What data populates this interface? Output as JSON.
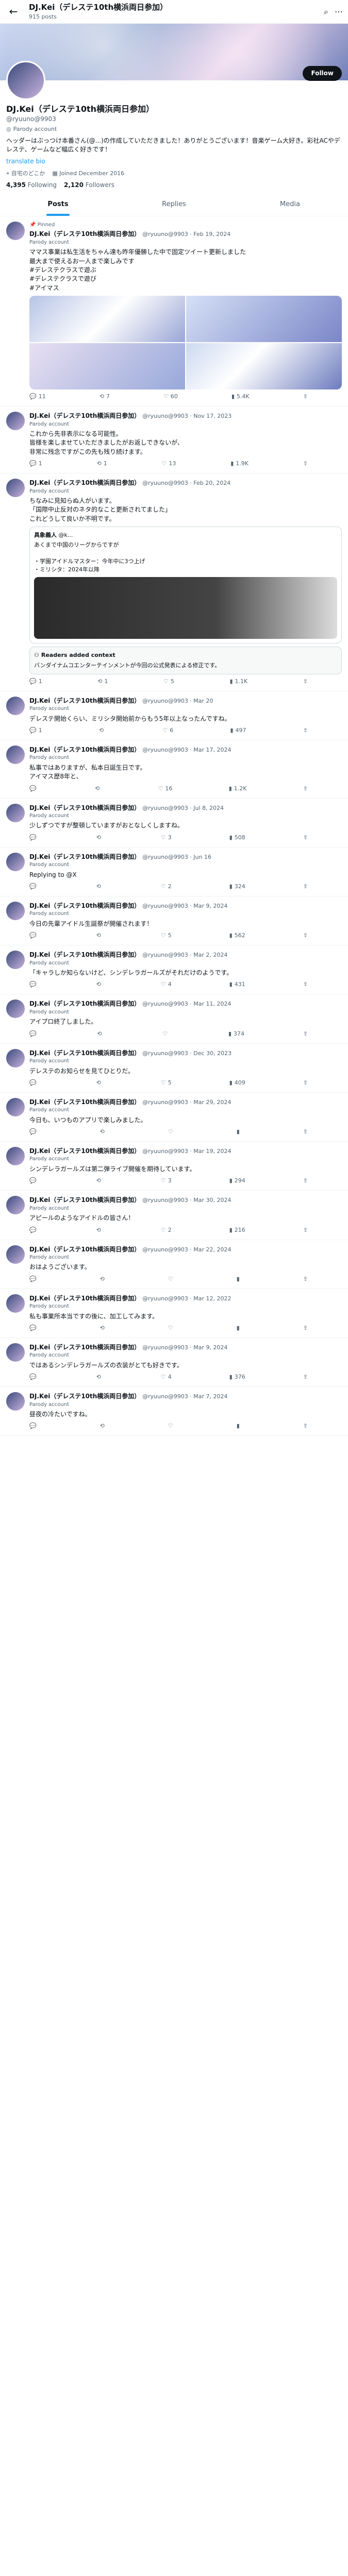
{
  "top": {
    "name": "DJ.Kei（デレステ10th横浜両日参加）",
    "posts": "915 posts"
  },
  "profile": {
    "name": "DJ.Kei（デレステ10th横浜両日参加）",
    "handle": "@ryuuno@9903",
    "parody": "Parody account",
    "follow": "Follow",
    "bio": "ヘッダーはぶっつけ本番さん(@...)の作成していただきました！ありがとうございます！音楽ゲーム大好き。彩社ACやデレステ、ゲームなど幅広く好きです！",
    "bio2": "translate bio",
    "location": "自宅のどこか",
    "joined": "Joined December 2016",
    "following": "4,395",
    "following_label": "Following",
    "followers": "2,120",
    "followers_label": "Followers"
  },
  "tabs": {
    "posts": "Posts",
    "replies": "Replies",
    "media": "Media"
  },
  "posts": [
    {
      "pinned": "Pinned",
      "name": "DJ.Kei（デレステ10th横浜両日参加）",
      "handle": "@ryuuno@9903 · Feb 19, 2024",
      "parody": "Parody account",
      "text": "ママス事業は私生活をちゃん達も昨年優勝した中で固定ツイート更新しました\n最大まで使えるお一人まで楽しみです\n#デレステクラスで遊ぶ\n#デレステクラスで遊び\n#アイマス",
      "reply": "11",
      "rt": "7",
      "like": "60",
      "views": "5.4K",
      "imgs": true
    },
    {
      "name": "DJ.Kei（デレステ10th横浜両日参加）",
      "handle": "@ryuuno@9903 · Nov 17, 2023",
      "parody": "Parody account",
      "text": "これから先非表示になる可能性。\n皆様を楽しませていただきましたがお返しできないが、\n非常に残念ですがこの先も残り続けます。",
      "reply": "1",
      "rt": "1",
      "like": "13",
      "views": "1.9K"
    },
    {
      "name": "DJ.Kei（デレステ10th横浜両日参加）",
      "handle": "@ryuuno@9903 · Feb 20, 2024",
      "parody": "Parody account",
      "text": "ちなみに見知らぬ人がいます。\n「国際中止反対のネタ的なこと更新されてました」\nこれどうして良いか不明です。",
      "reply": "1",
      "rt": "1",
      "like": "5",
      "views": "1.1K",
      "quote": true
    },
    {
      "name": "DJ.Kei（デレステ10th横浜両日参加）",
      "handle": "@ryuuno@9903 · Mar 20",
      "parody": "Parody account",
      "text": "デレステ開始くらい、ミリシタ開始前からもう5年以上なったんですね。",
      "reply": "1",
      "rt": "",
      "like": "6",
      "views": "497"
    },
    {
      "name": "DJ.Kei（デレステ10th横浜両日参加）",
      "handle": "@ryuuno@9903 · Mar 17, 2024",
      "parody": "Parody account",
      "text": "私事ではありますが、私本日誕生日です。\nアイマス歴8年と、",
      "reply": "",
      "rt": "",
      "like": "16",
      "views": "1.2K"
    },
    {
      "name": "DJ.Kei（デレステ10th横浜両日参加）",
      "handle": "@ryuuno@9903 · Jul 8, 2024",
      "parody": "Parody account",
      "text": "少しずつですが整頓していますがおとなしくしますね。",
      "reply": "",
      "rt": "",
      "like": "3",
      "views": "508"
    },
    {
      "name": "DJ.Kei（デレステ10th横浜両日参加）",
      "handle": "@ryuuno@9903 · Jun 16",
      "parody": "Parody account",
      "text": "Replying to @X",
      "reply": "",
      "rt": "",
      "like": "2",
      "views": "324"
    },
    {
      "name": "DJ.Kei（デレステ10th横浜両日参加）",
      "handle": "@ryuuno@9903 · Mar 9, 2024",
      "parody": "Parody account",
      "text": "今日の先輩アイドル生誕祭が開催されます！",
      "reply": "",
      "rt": "",
      "like": "5",
      "views": "562"
    },
    {
      "name": "DJ.Kei（デレステ10th横浜両日参加）",
      "handle": "@ryuuno@9903 · Mar 2, 2024",
      "parody": "Parody account",
      "text": "「キャラしか知らないけど、シンデレラガールズがそれだけのようです。",
      "reply": "",
      "rt": "",
      "like": "4",
      "views": "431"
    },
    {
      "name": "DJ.Kei（デレステ10th横浜両日参加）",
      "handle": "@ryuuno@9903 · Mar 11, 2024",
      "parody": "Parody account",
      "text": "アイプロ終了しました。",
      "reply": "",
      "rt": "",
      "like": "",
      "views": "374"
    },
    {
      "name": "DJ.Kei（デレステ10th横浜両日参加）",
      "handle": "@ryuuno@9903 · Dec 30, 2023",
      "parody": "Parody account",
      "text": "デレステのお知らせを見てひとりだ。",
      "reply": "",
      "rt": "",
      "like": "5",
      "views": "409"
    },
    {
      "name": "DJ.Kei（デレステ10th横浜両日参加）",
      "handle": "@ryuuno@9903 · Mar 29, 2024",
      "parody": "Parody account",
      "text": "今日も、いつものアプリで楽しみました。",
      "reply": "",
      "rt": "",
      "like": "",
      "views": ""
    },
    {
      "name": "DJ.Kei（デレステ10th横浜両日参加）",
      "handle": "@ryuuno@9903 · Mar 19, 2024",
      "parody": "Parody account",
      "text": "シンデレラガールズは第二弾ライブ開催を期待しています。",
      "reply": "",
      "rt": "",
      "like": "3",
      "views": "294"
    },
    {
      "name": "DJ.Kei（デレステ10th横浜両日参加）",
      "handle": "@ryuuno@9903 · Mar 30, 2024",
      "parody": "Parody account",
      "text": "アピールのようなアイドルの皆さん！",
      "reply": "",
      "rt": "",
      "like": "2",
      "views": "216"
    },
    {
      "name": "DJ.Kei（デレステ10th横浜両日参加）",
      "handle": "@ryuuno@9903 · Mar 22, 2024",
      "parody": "Parody account",
      "text": "おはようございます。",
      "reply": "",
      "rt": "",
      "like": "",
      "views": ""
    },
    {
      "name": "DJ.Kei（デレステ10th横浜両日参加）",
      "handle": "@ryuuno@9903 · Mar 12, 2022",
      "parody": "Parody account",
      "text": "私も事業所本当ですの後に、加工してみます。",
      "reply": "",
      "rt": "",
      "like": "",
      "views": ""
    },
    {
      "name": "DJ.Kei（デレステ10th横浜両日参加）",
      "handle": "@ryuuno@9903 · Mar 9, 2024",
      "parody": "Parody account",
      "text": "ではあるシンデレラガールズの衣装がとても好きです。",
      "reply": "",
      "rt": "",
      "like": "4",
      "views": "376"
    },
    {
      "name": "DJ.Kei（デレステ10th横浜両日参加）",
      "handle": "@ryuuno@9903 · Mar 7, 2024",
      "parody": "Parody account",
      "text": "昼夜の冷たいですね。",
      "reply": "",
      "rt": "",
      "like": "",
      "views": ""
    }
  ],
  "quote": {
    "name": "具象義人",
    "handle": "@k...",
    "text": "あくまで中国のリーグからですが\n\n・学園アイドルマスター：今年中に3つ上げ\n・ミリシタ：2024年以降",
    "note_head": "Readers added context",
    "note": "バンダイナムコエンターテインメントが今回の公式発表による修正です。"
  }
}
